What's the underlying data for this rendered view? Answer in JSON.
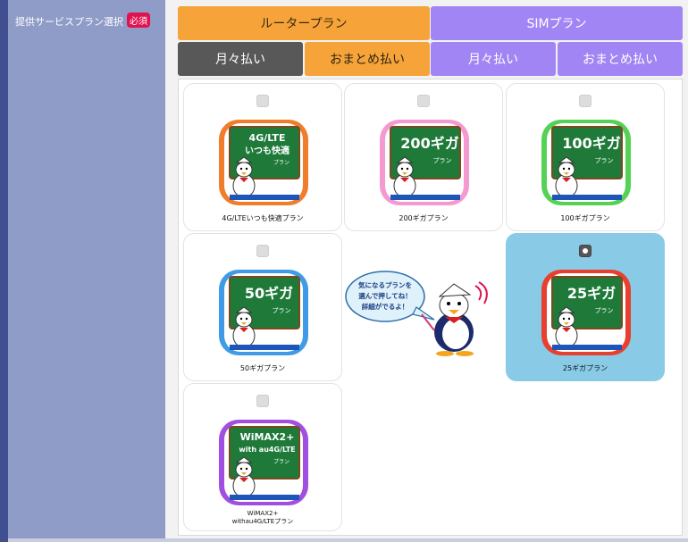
{
  "sidebar": {
    "label": "提供サービスプラン選択",
    "required_badge": "必須"
  },
  "tabs": {
    "router": "ルータープラン",
    "sim": "SIMプラン",
    "router_monthly": "月々払い",
    "router_lump": "おまとめ払い",
    "sim_monthly": "月々払い",
    "sim_lump": "おまとめ払い"
  },
  "plans": [
    {
      "name": "4G/LTEいつも快適プラン",
      "icon_line1": "4G/LTE",
      "icon_line2": "いつも快適",
      "icon_line3": "プラン",
      "side_color": "#f07d2c",
      "selected": false
    },
    {
      "name": "200ギガプラン",
      "icon_line1": "200ギガ",
      "icon_line2": "プラン",
      "side_color": "#f59ad0",
      "selected": false
    },
    {
      "name": "100ギガプラン",
      "icon_line1": "100ギガ",
      "icon_line2": "プラン",
      "side_color": "#55d155",
      "selected": false
    },
    {
      "name": "50ギガプラン",
      "icon_line1": "50ギガ",
      "icon_line2": "プラン",
      "side_color": "#3f9be6",
      "selected": false
    },
    {
      "name": "25ギガプラン",
      "icon_line1": "25ギガ",
      "icon_line2": "プラン",
      "side_color": "#e8402f",
      "selected": true
    },
    {
      "name_line1": "WiMAX2+",
      "name_line2": "withau4G/LTEプラン",
      "icon_line1": "WiMAX2+",
      "icon_line2": "with au4G/LTE",
      "icon_line3": "プラン",
      "side_color": "#a14fe0",
      "selected": false
    }
  ],
  "mascot": {
    "bubble_line1": "気になるプランを",
    "bubble_line2": "選んで押してね！",
    "bubble_line3": "詳細がでるよ！"
  },
  "colors": {
    "router_tab": "#f6a33a",
    "sim_tab": "#a285f4",
    "active_subtab": "#585858",
    "selected_card": "#89cbe7",
    "sidebar": "#8f9cc8",
    "required_badge": "#e0134f",
    "chalkboard": "#1f7a3a"
  }
}
